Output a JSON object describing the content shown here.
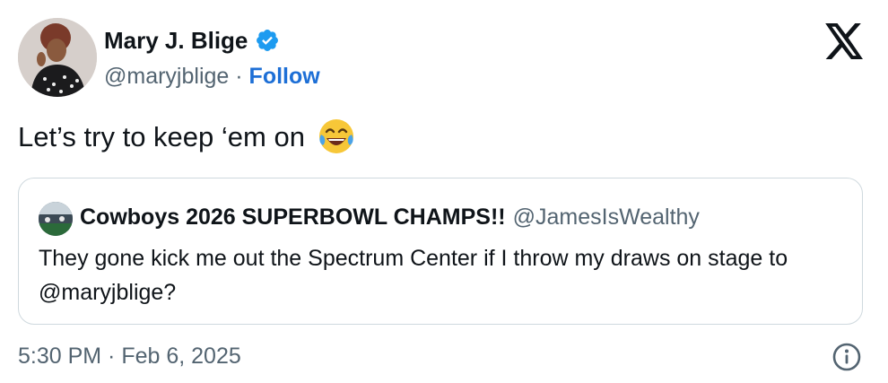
{
  "author": {
    "name": "Mary J. Blige",
    "handle": "@maryjblige",
    "separator": "·",
    "follow_label": "Follow",
    "verified": true
  },
  "tweet": {
    "text": "Let’s try to keep ‘em on",
    "emoji": "face-with-tears-of-joy"
  },
  "quoted_tweet": {
    "name": "Cowboys 2026 SUPERBOWL CHAMPS!!",
    "handle": "@JamesIsWealthy",
    "text": "They gone kick me out the Spectrum Center if I throw my draws on stage to @maryjblige?"
  },
  "footer": {
    "timestamp": "5:30 PM · Feb 6, 2025"
  },
  "icons": {
    "logo": "x-logo-icon",
    "verified": "verified-badge-icon",
    "info": "info-icon"
  },
  "colors": {
    "accent": "#1d6fd6",
    "verified_badge": "#1d9bf0",
    "secondary_text": "#536471",
    "border": "#cfd9de"
  }
}
